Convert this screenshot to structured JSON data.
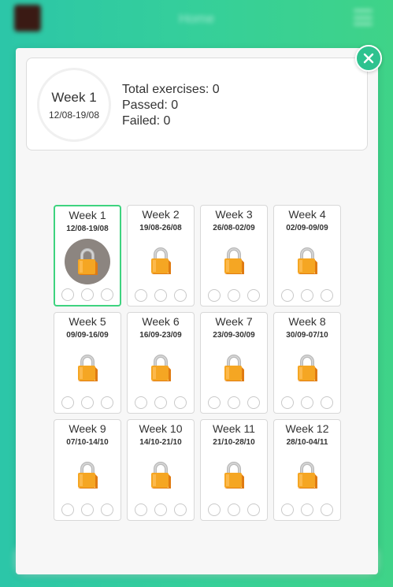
{
  "app": {
    "title": "Home"
  },
  "summary": {
    "week": "Week 1",
    "range": "12/08-19/08",
    "total": "Total exercises: 0",
    "passed": "Passed: 0",
    "failed": "Failed: 0"
  },
  "weeks": [
    {
      "name": "Week 1",
      "range": "12/08-19/08",
      "state": "current"
    },
    {
      "name": "Week 2",
      "range": "19/08-26/08",
      "state": "locked"
    },
    {
      "name": "Week 3",
      "range": "26/08-02/09",
      "state": "locked"
    },
    {
      "name": "Week 4",
      "range": "02/09-09/09",
      "state": "locked"
    },
    {
      "name": "Week 5",
      "range": "09/09-16/09",
      "state": "locked"
    },
    {
      "name": "Week 6",
      "range": "16/09-23/09",
      "state": "locked"
    },
    {
      "name": "Week 7",
      "range": "23/09-30/09",
      "state": "locked"
    },
    {
      "name": "Week 8",
      "range": "30/09-07/10",
      "state": "locked"
    },
    {
      "name": "Week 9",
      "range": "07/10-14/10",
      "state": "locked"
    },
    {
      "name": "Week 10",
      "range": "14/10-21/10",
      "state": "locked"
    },
    {
      "name": "Week 11",
      "range": "21/10-28/10",
      "state": "locked"
    },
    {
      "name": "Week 12",
      "range": "28/10-04/11",
      "state": "locked"
    }
  ],
  "colors": {
    "accent": "#3ed37f",
    "close": "#2ec28f",
    "lock": "#f5a623"
  }
}
